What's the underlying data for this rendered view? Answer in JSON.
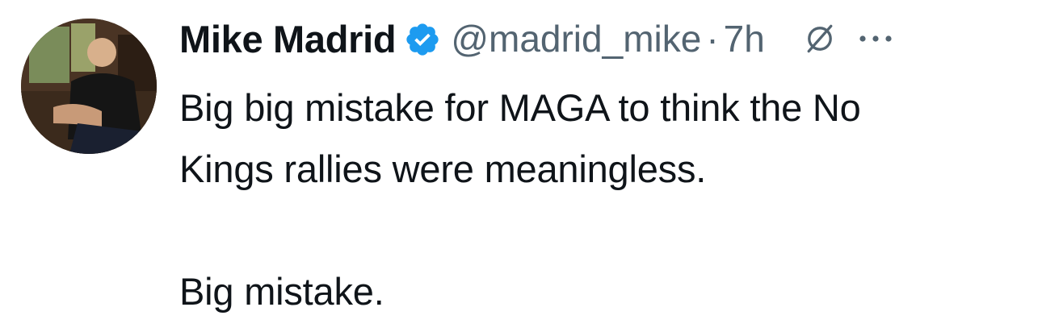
{
  "tweet": {
    "author": {
      "display_name": "Mike Madrid",
      "handle": "@madrid_mike",
      "verified": true,
      "avatar_icon": "profile-photo"
    },
    "separator": "·",
    "timestamp": "7h",
    "text_lines": [
      "Big big mistake for MAGA to think the No",
      "Kings rallies were meaningless."
    ],
    "text_line_2": "Big mistake.",
    "icons": {
      "verified": "verified-badge-icon",
      "grok": "grok-icon",
      "more": "more-options-icon"
    },
    "colors": {
      "name": "#0f1419",
      "secondary": "#536471",
      "verified": "#1d9bf0"
    }
  }
}
